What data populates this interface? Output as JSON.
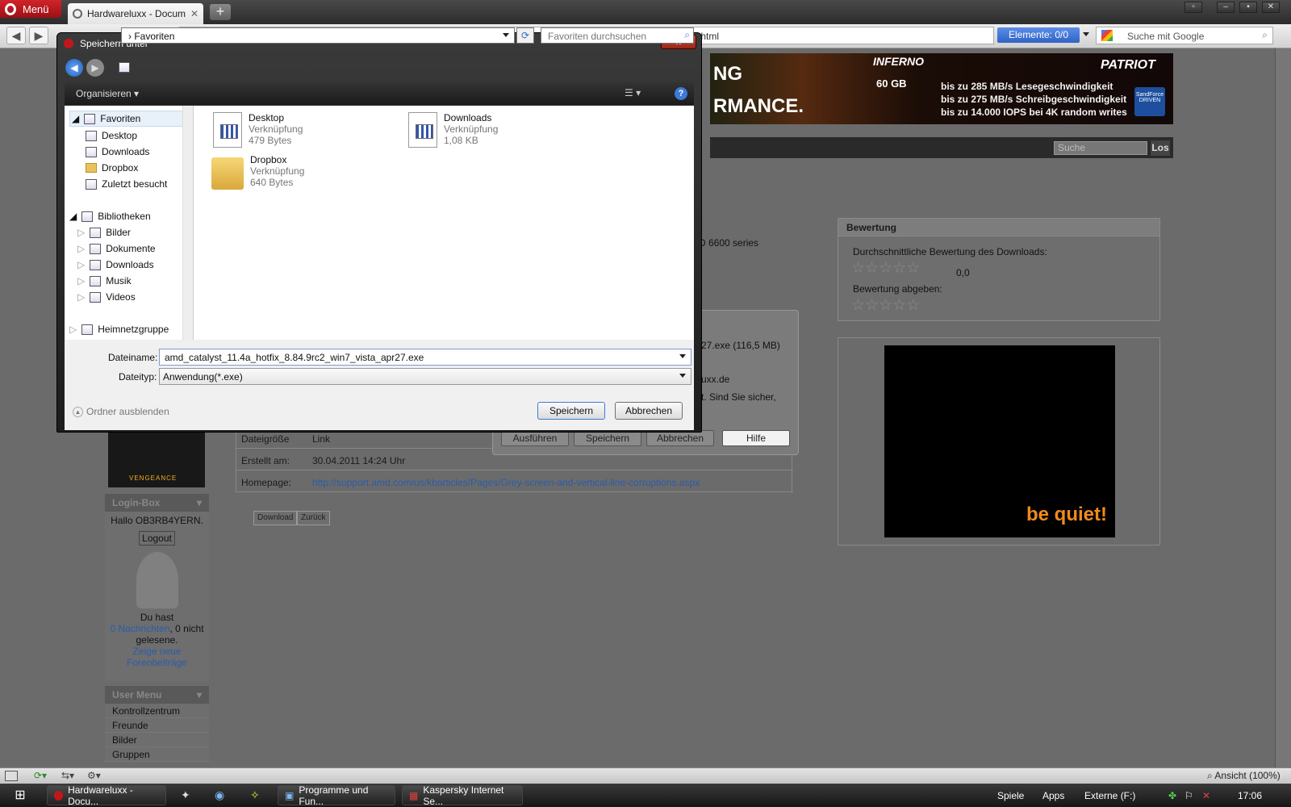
{
  "browser": {
    "menu_label": "Menü",
    "tab_title": "Hardwareluxx - Docum...",
    "url_tail": "vista.html",
    "elements_label": "Elemente:",
    "elements_value": "0/0",
    "search_placeholder": "Suche mit Google"
  },
  "page": {
    "banner_brand": "INFERNO",
    "banner_size": "60 GB",
    "banner_partial1": "NG",
    "banner_partial2": "RMANCE.",
    "banner_logo": "PATRIOT",
    "banner_lines": [
      "bis zu 285 MB/s Lesegeschwindigkeit",
      "bis zu 275 MB/s Schreibgeschwindigkeit",
      "bis zu 14.000 IOPS bei 4K random writes"
    ],
    "banner_badge": "SandForce DRIVEN",
    "search_placeholder": "Suche",
    "search_button": "Los",
    "partial_text": "D 6600 series",
    "rating": {
      "title": "Bewertung",
      "average_label": "Durchschnittliche Bewertung des Downloads:",
      "average_value": "0,0",
      "give_label": "Bewertung abgeben:"
    },
    "ad_brand": "be quiet!",
    "ad_vengeance": "VENGEANCE",
    "details": [
      {
        "key": "Dateigröße",
        "value": "Link"
      },
      {
        "key": "Erstellt am:",
        "value": "30.04.2011 14:24 Uhr"
      },
      {
        "key": "Homepage:",
        "value": "http://support.amd.com/us/kbarticles/Pages/Grey-screen-and-vertical-line-corruptions.aspx"
      }
    ],
    "download_button": "Download",
    "back_button": "Zurück",
    "login_box": {
      "title": "Login-Box",
      "greeting": "Hallo OB3RB4YERN.",
      "logout": "Logout",
      "du_hast": "Du hast",
      "messages_link": "0 Nachrichten",
      "messages_rest": ", 0 nicht",
      "gelesene": "gelesene.",
      "show_new": "Zeige neue",
      "forum_posts": "Forenbeiträge"
    },
    "user_menu": {
      "title": "User Menu",
      "items": [
        "Kontrollzentrum",
        "Freunde",
        "Bilder",
        "Gruppen"
      ]
    }
  },
  "opera_dialog": {
    "line1": "27.exe (116,5 MB)",
    "line2": "uxx.de",
    "line3": "t. Sind Sie sicher,",
    "buttons": [
      "Ausführen",
      "Speichern",
      "Abbrechen",
      "Hilfe"
    ]
  },
  "save_dialog": {
    "title": "Speichern unter",
    "close": "x",
    "path": "Favoriten",
    "search_placeholder": "Favoriten durchsuchen",
    "organise": "Organisieren",
    "help": "?",
    "tree": {
      "favorites": "Favoriten",
      "fav_items": [
        "Desktop",
        "Downloads",
        "Dropbox",
        "Zuletzt besucht"
      ],
      "libraries": "Bibliotheken",
      "lib_items": [
        "Bilder",
        "Dokumente",
        "Downloads",
        "Musik",
        "Videos"
      ],
      "homegroup": "Heimnetzgruppe"
    },
    "files": [
      {
        "name": "Desktop",
        "type": "Verknüpfung",
        "size": "479 Bytes"
      },
      {
        "name": "Downloads",
        "type": "Verknüpfung",
        "size": "1,08 KB"
      },
      {
        "name": "Dropbox",
        "type": "Verknüpfung",
        "size": "640 Bytes"
      }
    ],
    "filename_label": "Dateiname:",
    "filename_value": "amd_catalyst_11.4a_hotfix_8.84.9rc2_win7_vista_apr27.exe",
    "filetype_label": "Dateityp:",
    "filetype_value": "Anwendung(*.exe)",
    "hide_folders": "Ordner ausblenden",
    "save_button": "Speichern",
    "cancel_button": "Abbrechen"
  },
  "statusbar": {
    "zoom": "Ansicht (100%)"
  },
  "taskbar": {
    "items": [
      "Hardwareluxx - Docu...",
      "Programme und Fun...",
      "Kaspersky Internet Se..."
    ],
    "tray": [
      "Spiele",
      "Apps",
      "Externe (F:)"
    ],
    "clock": "17:06"
  }
}
